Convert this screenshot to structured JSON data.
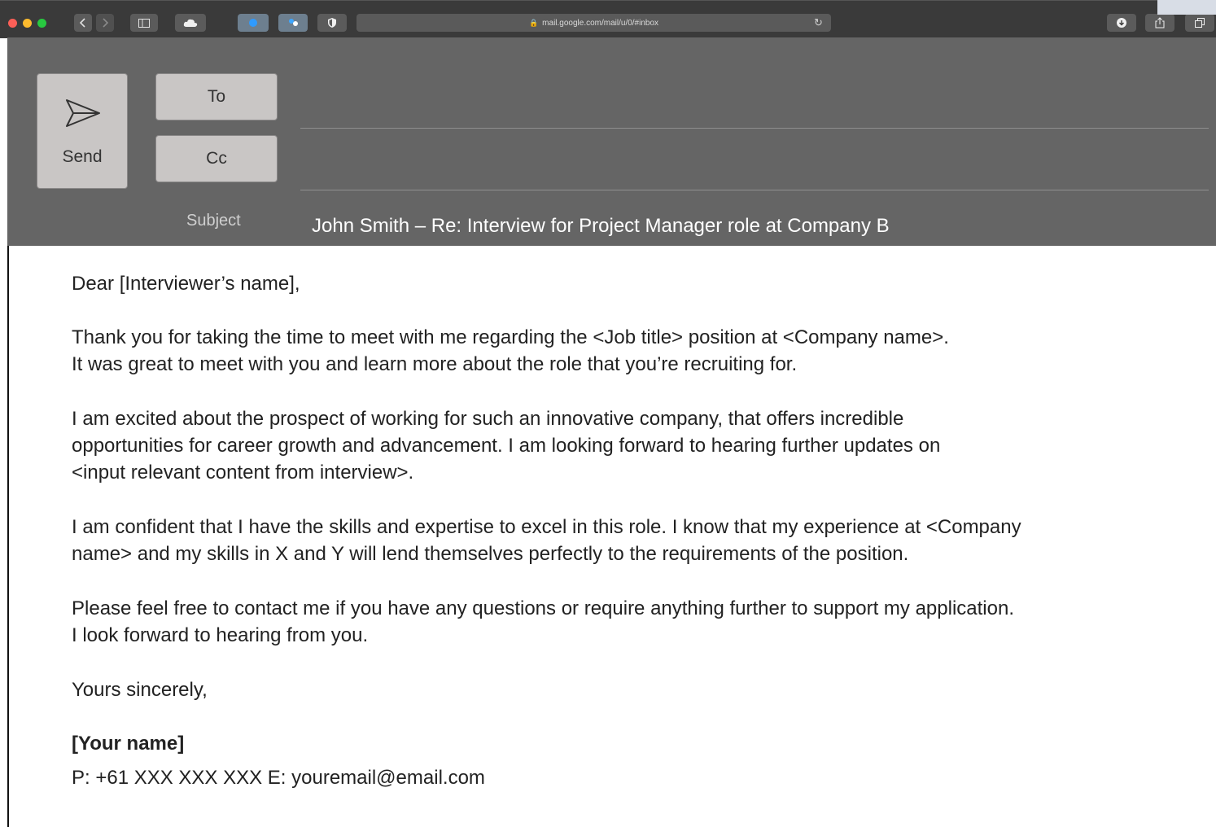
{
  "browser": {
    "url": "mail.google.com/mail/u/0/#inbox",
    "colors": {
      "close": "#fc5f57",
      "minimize": "#fdbb2e",
      "zoom": "#28c840"
    }
  },
  "compose": {
    "send_label": "Send",
    "to_label": "To",
    "cc_label": "Cc",
    "subject_label": "Subject",
    "subject_value": "John Smith – Re: Interview for Project Manager role at Company B"
  },
  "message": {
    "greeting": "Dear [Interviewer’s name],",
    "p1_l1": "Thank you for taking the time to meet with me regarding the <Job title> position at <Company name>.",
    "p1_l2": "It was great to meet with you and learn more about the role that you’re recruiting for.",
    "p2_l1": "I am excited about the prospect of working for such an innovative company, that offers incredible",
    "p2_l2": "opportunities for career growth and advancement. I am looking forward to hearing further updates on",
    "p2_l3": "<input relevant content from interview>.",
    "p3_l1": "I am confident that I have the skills and expertise to excel in this role. I know that my experience at <Company",
    "p3_l2": "name> and my skills in X and Y will lend themselves perfectly to the requirements of the position.",
    "p4_l1": "Please feel free to contact me if you have any questions or require anything further to support my application.",
    "p4_l2": "I look forward to hearing from you.",
    "closing": "Yours sincerely,",
    "signature_name": "[Your name]",
    "signature_contact": "P: +61 XXX XXX XXX E: youremail@email.com"
  }
}
